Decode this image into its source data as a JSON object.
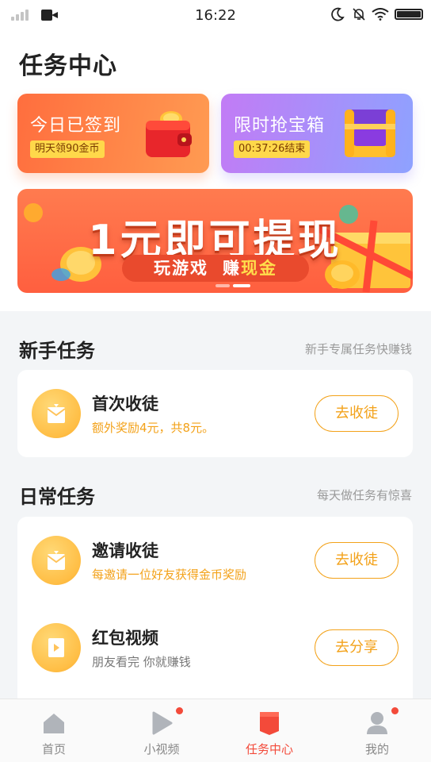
{
  "status_bar": {
    "time": "16:22",
    "icons": [
      "signal-icon",
      "video-camera-icon",
      "moon-icon",
      "bell-muted-icon",
      "wifi-icon",
      "battery-icon"
    ]
  },
  "page_title": "任务中心",
  "promo_cards": {
    "signin": {
      "title": "今日已签到",
      "tag": "明天领90金币",
      "icon": "wallet-icon"
    },
    "chest": {
      "title": "限时抢宝箱",
      "tag": "00:37:26结束",
      "icon": "treasure-chest-icon"
    }
  },
  "banner": {
    "headline": "1元即可提现",
    "pill_part1": "玩游戏",
    "pill_part2": "赚",
    "pill_part3": "现金",
    "carousel_index": 2,
    "carousel_count": 2
  },
  "newbie_section": {
    "title": "新手任务",
    "subtitle": "新手专属任务快赚钱",
    "tasks": [
      {
        "name": "首次收徒",
        "desc": "额外奖励4元，共8元。",
        "button": "去收徒",
        "icon": "envelope-icon"
      }
    ]
  },
  "daily_section": {
    "title": "日常任务",
    "subtitle": "每天做任务有惊喜",
    "tasks": [
      {
        "name": "邀请收徒",
        "desc": "每邀请一位好友获得金币奖励",
        "button": "去收徒",
        "icon": "envelope-icon"
      },
      {
        "name": "红包视频",
        "desc": "朋友看完 你就赚钱",
        "button": "去分享",
        "icon": "video-envelope-icon"
      }
    ]
  },
  "tabbar": {
    "active": "任务中心",
    "tabs": [
      {
        "label": "首页",
        "icon": "home-icon",
        "badge": false
      },
      {
        "label": "小视频",
        "icon": "play-icon",
        "badge": true
      },
      {
        "label": "任务中心",
        "icon": "task-ribbon-icon",
        "badge": false
      },
      {
        "label": "我的",
        "icon": "user-icon",
        "badge": true
      }
    ]
  },
  "colors": {
    "accent_orange": "#f3a21a",
    "active_red": "#f34a3a",
    "signin_gradient_start": "#ff6e3e",
    "chest_gradient_start": "#c27bf5",
    "banner_bg": "#ff6a45"
  }
}
